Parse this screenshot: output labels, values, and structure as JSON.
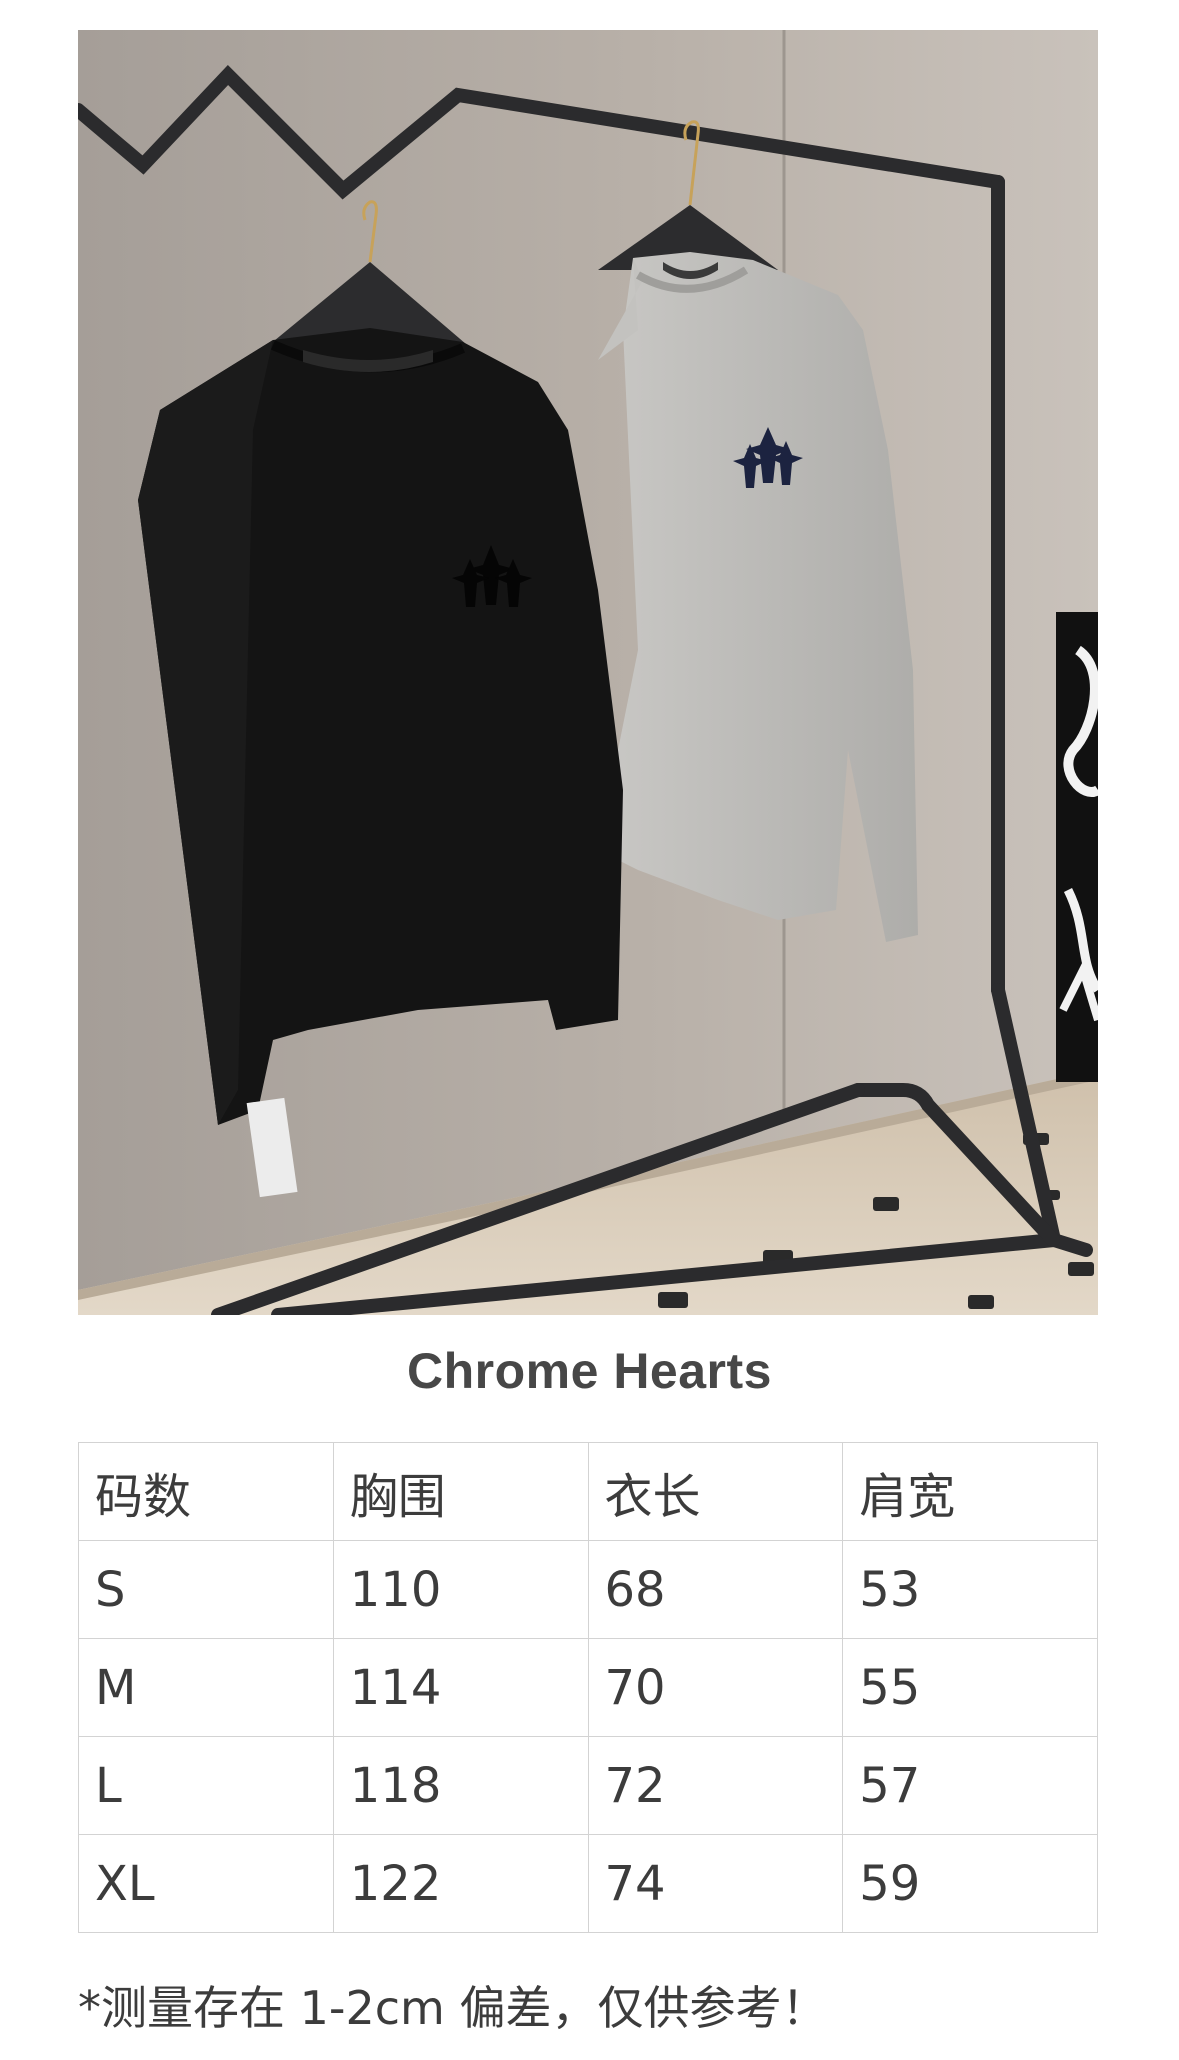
{
  "photo": {
    "alt_subject": "two long-sleeve tees on a rack"
  },
  "brand_title": "Chrome Hearts",
  "size_table": {
    "headers": [
      "码数",
      "胸围",
      "衣长",
      "肩宽"
    ],
    "rows": [
      [
        "S",
        "110",
        "68",
        "53"
      ],
      [
        "M",
        "114",
        "70",
        "55"
      ],
      [
        "L",
        "118",
        "72",
        "57"
      ],
      [
        "XL",
        "122",
        "74",
        "59"
      ]
    ]
  },
  "note": "*测量存在 1-2cm 偏差，仅供参考！",
  "colors": {
    "wall": "#b3aba4",
    "floor": "#d7c9b6",
    "rack": "#2b2b2d",
    "black_tee": "#141414",
    "grey_tee": "#bdbcb9",
    "table_border": "#d3d3d3"
  }
}
